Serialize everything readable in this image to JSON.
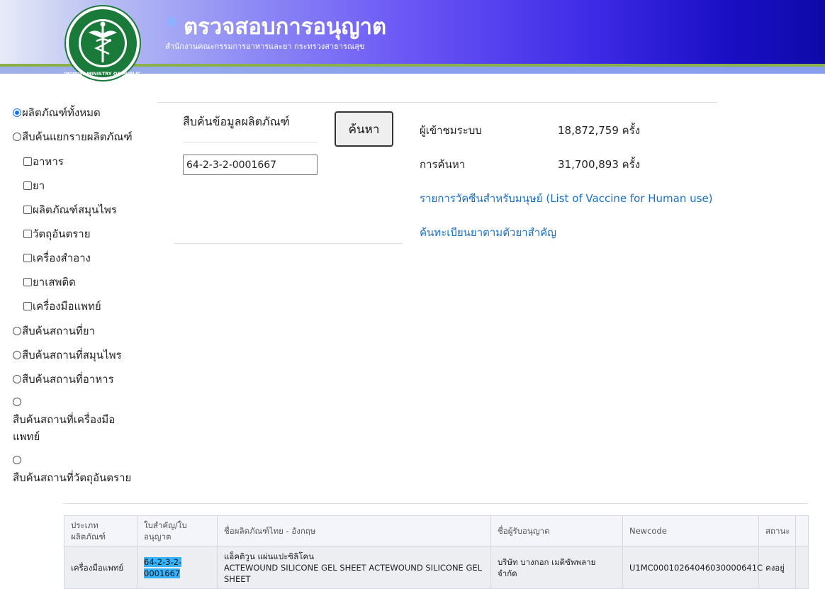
{
  "header": {
    "title": "ตรวจสอบการอนุญาต",
    "subtitle": "สำนักงานคณะกรรมการอาหารและยา กระทรวงสาธารณสุข",
    "logo_text": "กระทรวงสาธารณสุข MINISTRY OF PUBLIC HEALTH"
  },
  "options": {
    "all_products": "ผลิตภัณฑ์ทั้งหมด",
    "by_product": "สืบค้นแยกรายผลิตภัณฑ์",
    "food": "อาหาร",
    "drug": "ยา",
    "herbal": "ผลิตภัณฑ์สมุนไพร",
    "hazardous": "วัตถุอันตราย",
    "cosmetic": "เครื่องสำอาง",
    "narcotic": "ยาเสพติด",
    "medical_device": "เครื่องมือแพทย์",
    "drug_place": "สืบค้นสถานที่ยา",
    "herbal_place": "สืบค้นสถานที่สมุนไพร",
    "food_place": "สืบค้นสถานที่อาหาร",
    "device_place_line1": "สืบค้นสถานที่เครื่องมือ",
    "device_place_line2": "แพทย์",
    "hazard_place": "สืบค้นสถานที่วัตถุอันตราย"
  },
  "search": {
    "label": "สืบค้นข้อมูลผลิตภัณฑ์",
    "value": "64-2-3-2-0001667",
    "button": "ค้นหา"
  },
  "stats": {
    "visitors_label": "ผู้เข้าชมระบบ",
    "visitors_value": "18,872,759 ครั้ง",
    "searches_label": "การค้นหา",
    "searches_value": "31,700,893 ครั้ง",
    "vaccine_link": "รายการวัคซีนสำหรับมนุษย์ (List of Vaccine for Human use)",
    "drug_link": "ค้นทะเบียนยาตามตัวยาสำคัญ"
  },
  "table": {
    "headers": {
      "type_1": "ประเภท",
      "type_2": "ผลิตภัณฑ์",
      "license_1": "ใบสำคัญ/ใบ",
      "license_2": "อนุญาต",
      "name": "ชื่อผลิตภัณฑ์ไทย - อังกฤษ",
      "licensee": "ชื่อผู้รับอนุญาต",
      "newcode": "Newcode",
      "status": "สถานะ"
    },
    "row": {
      "type": "เครื่องมือแพทย์",
      "license": "64-2-3-2-0001667",
      "name_th": "แอ็คติวูน แผ่นแปะซิลิโคน",
      "name_en_1": "ACTEWOUND SILICONE GEL SHEET ACTEWOUND SILICONE GEL",
      "name_en_2": "SHEET",
      "licensee_1": "บริษัท บางกอก เมดิซัพพลาย",
      "licensee_2": "จำกัด",
      "newcode": "U1MC00010264046030000641C",
      "status": "คงอยู่"
    }
  }
}
